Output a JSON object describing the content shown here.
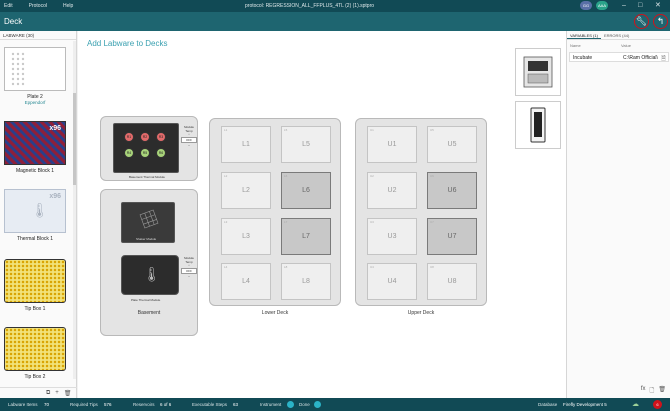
{
  "menubar": {
    "items": [
      "Edit",
      "Protocol",
      "Help"
    ],
    "window_title": "protocol: REGRESSION_ALL_FFPLUS_4TL (2) (1).sptpro",
    "avatars": [
      "GG",
      "AAA"
    ]
  },
  "header": {
    "title": "Deck"
  },
  "left_panel": {
    "heading": "LABWARE (30)",
    "items": [
      {
        "name": "Plate 2",
        "sub": "Eppendorf"
      },
      {
        "name": "Magnetic Block 1",
        "badge": "x96"
      },
      {
        "name": "Thermal Block 1",
        "badge": "x96"
      },
      {
        "name": "Tip Box 1"
      },
      {
        "name": "Tip Box 2"
      }
    ]
  },
  "main": {
    "title": "Add Labware to Decks",
    "basement": {
      "label": "Basement",
      "thermal_module": {
        "wells": [
          "R1",
          "R2",
          "R3",
          "R4",
          "R5",
          "R6"
        ],
        "ctrl_label": "Module Temp",
        "ctrl_value": "OFF",
        "name": "Basement Thermal Module"
      },
      "shaker_module": {
        "name": "Shaker Module"
      },
      "plate_thermal": {
        "ctrl_label": "Module Temp",
        "ctrl_value": "OFF",
        "name": "Plate Thermal Module"
      }
    },
    "lower_deck": {
      "label": "Lower Deck",
      "slots": [
        {
          "id": "L1"
        },
        {
          "id": "L5"
        },
        {
          "id": "L2"
        },
        {
          "id": "L6",
          "filled": true
        },
        {
          "id": "L3"
        },
        {
          "id": "L7",
          "filled": true
        },
        {
          "id": "L4"
        },
        {
          "id": "L8"
        }
      ]
    },
    "upper_deck": {
      "label": "Upper Deck",
      "slots": [
        {
          "id": "U1"
        },
        {
          "id": "U5"
        },
        {
          "id": "U2"
        },
        {
          "id": "U6",
          "filled": true
        },
        {
          "id": "U3"
        },
        {
          "id": "U7",
          "filled": true
        },
        {
          "id": "U4"
        },
        {
          "id": "U8"
        }
      ]
    }
  },
  "right_panel": {
    "tabs": [
      "VARIABLES (1)",
      "ERRORS (44)"
    ],
    "columns": [
      "Name",
      "Value"
    ],
    "rows": [
      {
        "name": "Incubate",
        "value": "C:\\Ram Official\\"
      }
    ]
  },
  "status": {
    "labware_items_label": "Labware Items",
    "labware_items": "70",
    "required_tips_label": "Required Tips",
    "required_tips": "576",
    "reservoirs_label": "Reservoirs",
    "reservoirs": "6 of 6",
    "executable_steps_label": "Executable Steps",
    "executable_steps": "63",
    "instrument_label": "Instrument",
    "done_label": "Done",
    "database_label": "Database",
    "database": "Firefly Development 5",
    "error_count": "6"
  },
  "colors": {
    "accent": "#1e6570",
    "menubar": "#114a55",
    "error": "#d0121b"
  }
}
